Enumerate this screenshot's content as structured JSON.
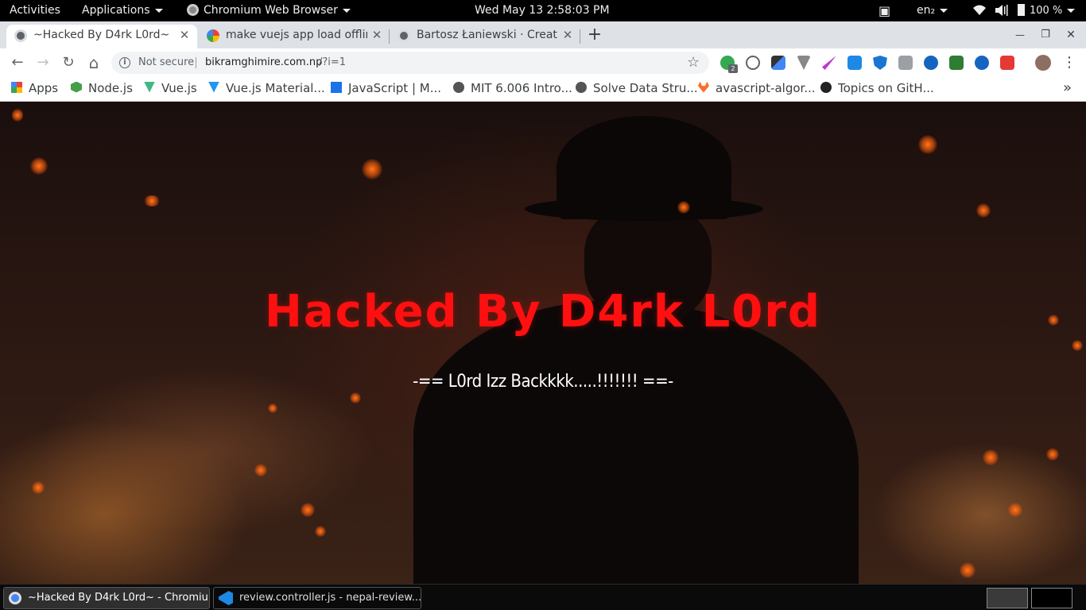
{
  "topbar": {
    "activities": "Activities",
    "applications": "Applications",
    "app_name": "Chromium Web Browser",
    "clock": "Wed May 13   2:58:03 PM",
    "keyboard": "en₂",
    "battery": "100 %"
  },
  "tabs": [
    {
      "title": "~Hacked By D4rk L0rd~",
      "close": "✕"
    },
    {
      "title": "make vuejs app load offline",
      "close": "✕"
    },
    {
      "title": "Bartosz Łaniewski · Creating",
      "close": "✕"
    }
  ],
  "new_tab": "+",
  "window_controls": {
    "minimize": "—",
    "maximize": "❐",
    "close": "✕"
  },
  "toolbar": {
    "back": "←",
    "forward": "→",
    "reload": "↻",
    "home": "⌂",
    "security_label": "Not secure",
    "url_host": "bikramghimire.com.np",
    "url_path": "/?i=1",
    "star": "☆",
    "menu": "⋮",
    "extension_badge": "2"
  },
  "bookmarks": [
    {
      "label": "Apps",
      "color": "#4285f4"
    },
    {
      "label": "Node.js",
      "color": "#43a047"
    },
    {
      "label": "Vue.js",
      "color": "#41b883"
    },
    {
      "label": "Vue.js Material...",
      "color": "#2196f3"
    },
    {
      "label": "JavaScript | M...",
      "color": "#1a73e8"
    },
    {
      "label": "MIT 6.006 Intro...",
      "color": "#555555"
    },
    {
      "label": "Solve Data Stru...",
      "color": "#555555"
    },
    {
      "label": "avascript-algor...",
      "color": "#fc6d26"
    },
    {
      "label": "Topics on GitH...",
      "color": "#222222"
    }
  ],
  "bookmarks_overflow": "»",
  "page": {
    "headline": "Hacked By D4rk L0rd",
    "subline": "-== L0rd Izz Backkkk.....!!!!!!! ==-"
  },
  "taskbar": {
    "items": [
      {
        "label": "~Hacked By D4rk L0rd~ - Chromiu..."
      },
      {
        "label": "review.controller.js - nepal-review..."
      }
    ]
  },
  "colors": {
    "headline": "#ff1010",
    "chrome_frame": "#dee1e6",
    "omnibox": "#f1f3f4"
  }
}
